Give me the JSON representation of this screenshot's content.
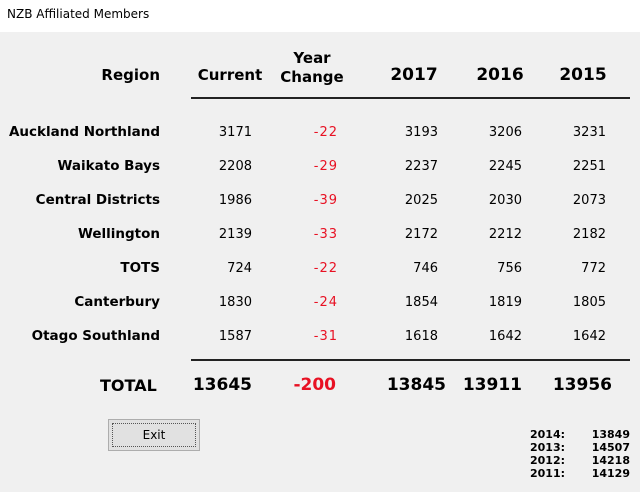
{
  "window": {
    "title": "NZB Affiliated Members"
  },
  "headers": {
    "region": "Region",
    "current": "Current",
    "year_change_1": "Year",
    "year_change_2": "Change",
    "y2017": "2017",
    "y2016": "2016",
    "y2015": "2015"
  },
  "rows": [
    {
      "region": "Auckland Northland",
      "current": "3171",
      "change": "-22",
      "y2017": "3193",
      "y2016": "3206",
      "y2015": "3231"
    },
    {
      "region": "Waikato Bays",
      "current": "2208",
      "change": "-29",
      "y2017": "2237",
      "y2016": "2245",
      "y2015": "2251"
    },
    {
      "region": "Central Districts",
      "current": "1986",
      "change": "-39",
      "y2017": "2025",
      "y2016": "2030",
      "y2015": "2073"
    },
    {
      "region": "Wellington",
      "current": "2139",
      "change": "-33",
      "y2017": "2172",
      "y2016": "2212",
      "y2015": "2182"
    },
    {
      "region": "TOTS",
      "current": "724",
      "change": "-22",
      "y2017": "746",
      "y2016": "756",
      "y2015": "772"
    },
    {
      "region": "Canterbury",
      "current": "1830",
      "change": "-24",
      "y2017": "1854",
      "y2016": "1819",
      "y2015": "1805"
    },
    {
      "region": "Otago Southland",
      "current": "1587",
      "change": "-31",
      "y2017": "1618",
      "y2016": "1642",
      "y2015": "1642"
    }
  ],
  "totals": {
    "label": "TOTAL",
    "current": "13645",
    "change": "-200",
    "y2017": "13845",
    "y2016": "13911",
    "y2015": "13956"
  },
  "exit_label": "Exit",
  "history": [
    {
      "year": "2014:",
      "value": "13849"
    },
    {
      "year": "2013:",
      "value": "14507"
    },
    {
      "year": "2012:",
      "value": "14218"
    },
    {
      "year": "2011:",
      "value": "14129"
    }
  ],
  "colors": {
    "negative": "#e81123",
    "background": "#f0f0f0",
    "titlebar": "#ffffff"
  }
}
